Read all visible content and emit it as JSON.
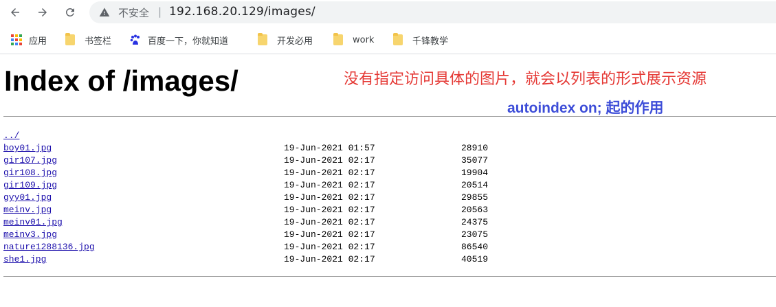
{
  "address_bar": {
    "security_label": "不安全",
    "separator": "|",
    "url": "192.168.20.129/images/"
  },
  "bookmarks": [
    {
      "label": "应用",
      "icon": "apps-grid-icon"
    },
    {
      "label": "书签栏",
      "icon": "folder-icon"
    },
    {
      "label": "百度一下，你就知道",
      "icon": "baidu-paw-icon"
    },
    {
      "label": "开发必用",
      "icon": "folder-icon"
    },
    {
      "label": "work",
      "icon": "folder-icon"
    },
    {
      "label": "千锋教学",
      "icon": "folder-icon"
    }
  ],
  "page": {
    "title": "Index of /images/",
    "parent_link": "../",
    "annotation_red": "没有指定访问具体的图片，就会以列表的形式展示资源",
    "annotation_blue": "autoindex on; 起的作用",
    "files": [
      {
        "name": "boy01.jpg",
        "date": "19-Jun-2021 01:57",
        "size": "28910"
      },
      {
        "name": "gir107.jpg",
        "date": "19-Jun-2021 02:17",
        "size": "35077"
      },
      {
        "name": "gir108.jpg",
        "date": "19-Jun-2021 02:17",
        "size": "19904"
      },
      {
        "name": "gir109.jpg",
        "date": "19-Jun-2021 02:17",
        "size": "20514"
      },
      {
        "name": "gyy01.jpg",
        "date": "19-Jun-2021 02:17",
        "size": "29855"
      },
      {
        "name": "meinv.jpg",
        "date": "19-Jun-2021 02:17",
        "size": "20563"
      },
      {
        "name": "meinv01.jpg",
        "date": "19-Jun-2021 02:17",
        "size": "24375"
      },
      {
        "name": "meinv3.jpg",
        "date": "19-Jun-2021 02:17",
        "size": "23075"
      },
      {
        "name": "nature1288136.jpg",
        "date": "19-Jun-2021 02:17",
        "size": "86540"
      },
      {
        "name": "she1.jpg",
        "date": "19-Jun-2021 02:17",
        "size": "40519"
      }
    ]
  },
  "colors": {
    "link": "#1a0dab",
    "annotation_red": "#e53935",
    "annotation_blue": "#3d4dd8"
  }
}
